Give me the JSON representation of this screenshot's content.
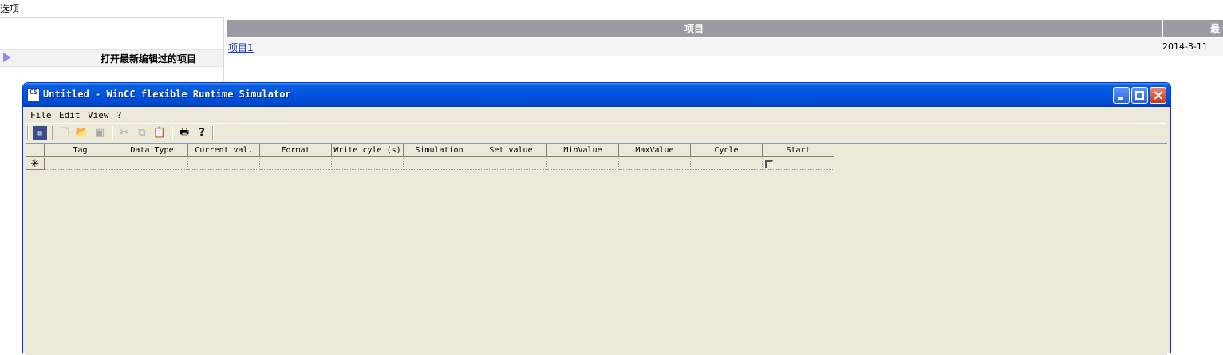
{
  "background_page": {
    "title": "选项",
    "recent_projects_label": "打开最新编辑过的项目",
    "table_headers": [
      "项目",
      "最"
    ],
    "rows": [
      {
        "project": "项目1",
        "date": "2014-3-11"
      }
    ]
  },
  "window": {
    "title": "Untitled - WinCC flexible Runtime Simulator",
    "icon_text": "CS",
    "menu": [
      "File",
      "Edit",
      "View",
      "?"
    ],
    "toolbar_icons": [
      "simulator-icon",
      "new-file-icon",
      "open-folder-icon",
      "save-icon",
      "cut-icon",
      "copy-icon",
      "paste-icon",
      "print-icon",
      "help-icon"
    ],
    "grid": {
      "columns": [
        "Tag",
        "Data Type",
        "Current val.",
        "Format",
        "Write cyle (s)",
        "Simulation",
        "Set value",
        "MinValue",
        "MaxValue",
        "Cycle",
        "Start"
      ],
      "new_row_marker": "✳"
    }
  },
  "colors": {
    "titlebar": "#0054e3",
    "window_bg": "#ece9d8",
    "header_bg": "#9b9ba4",
    "link": "#1f3fa8"
  }
}
